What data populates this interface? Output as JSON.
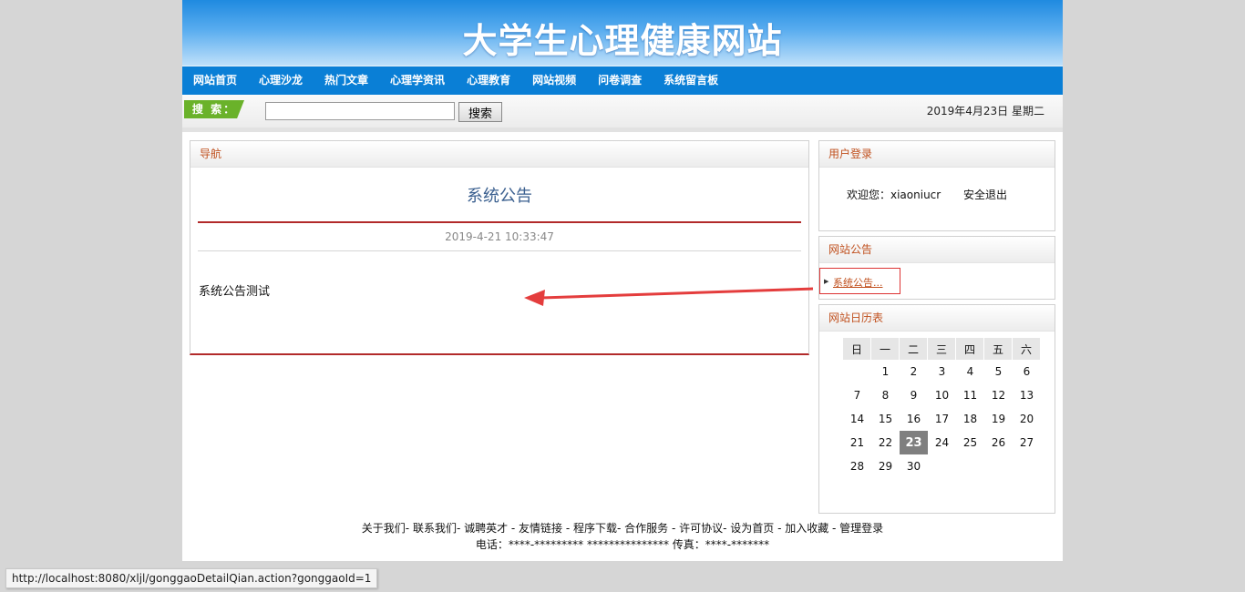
{
  "header": {
    "title": "大学生心理健康网站"
  },
  "nav": {
    "items": [
      {
        "label": "网站首页"
      },
      {
        "label": "心理沙龙"
      },
      {
        "label": "热门文章"
      },
      {
        "label": "心理学资讯"
      },
      {
        "label": "心理教育"
      },
      {
        "label": "网站视频"
      },
      {
        "label": "问卷调查"
      },
      {
        "label": "系统留言板"
      }
    ]
  },
  "search": {
    "tag": "搜 索：",
    "input_value": "",
    "button_label": "搜索",
    "date": "2019年4月23日 星期二"
  },
  "main": {
    "panel_title": "导航",
    "detail_title": "系统公告",
    "detail_date": "2019-4-21 10:33:47",
    "detail_body": "系统公告测试"
  },
  "sidebar": {
    "login": {
      "title": "用户登录",
      "welcome": "欢迎您：xiaoniucr",
      "logout": "安全退出"
    },
    "notice": {
      "title": "网站公告",
      "item": "系统公告..."
    },
    "calendar": {
      "title": "网站日历表",
      "weekdays": [
        "日",
        "一",
        "二",
        "三",
        "四",
        "五",
        "六"
      ],
      "weeks": [
        [
          "",
          "1",
          "2",
          "3",
          "4",
          "5",
          "6"
        ],
        [
          "7",
          "8",
          "9",
          "10",
          "11",
          "12",
          "13"
        ],
        [
          "14",
          "15",
          "16",
          "17",
          "18",
          "19",
          "20"
        ],
        [
          "21",
          "22",
          "23",
          "24",
          "25",
          "26",
          "27"
        ],
        [
          "28",
          "29",
          "30",
          "",
          "",
          "",
          ""
        ]
      ],
      "today": "23"
    }
  },
  "footer": {
    "links_line": "关于我们- 联系我们- 诚聘英才 - 友情链接 - 程序下载- 合作服务 - 许可协议- 设为首页 - 加入收藏 - 管理登录",
    "contact_line": "电话：****-********* *************** 传真：****-*******"
  },
  "status": {
    "url": "http://localhost:8080/xljl/gonggaoDetailQian.action?gonggaoId=1"
  },
  "colors": {
    "nav_bg": "#0a7fd6",
    "accent_red": "#b22a2a",
    "panel_title": "#c0501e",
    "search_tag": "#6ab22a"
  }
}
